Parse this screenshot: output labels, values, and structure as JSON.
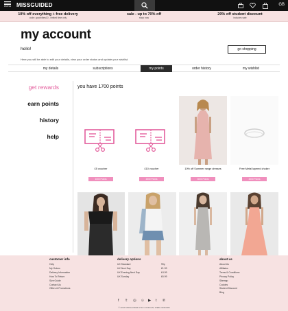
{
  "topbar": {
    "menu_label": "menu",
    "logo": "MISSGUIDED",
    "region": "GB"
  },
  "promo": [
    {
      "title": "10% off everything + free delivery",
      "sub": "code: goodvibes10 - limited time only"
    },
    {
      "title": "sale - up to 70% off",
      "sub": "shop now"
    },
    {
      "title": "20% off student discount",
      "sub": "includes sale"
    }
  ],
  "account": {
    "title": "my account",
    "greeting": "hello!",
    "shop_button": "go shopping",
    "description": "Here you will be able to edit your details, view your order status and update your wishlist."
  },
  "tabs": [
    "my details",
    "subscriptions",
    "my points",
    "order history",
    "my wishlist"
  ],
  "active_tab": "my points",
  "sidebar": [
    "get rewards",
    "earn points",
    "history",
    "help"
  ],
  "points_heading": "you have 1700 points",
  "rewards": [
    {
      "caption": "£5 voucher",
      "points": "1000 Points",
      "icon": "voucher-scissors-icon"
    },
    {
      "caption": "£10 voucher",
      "points": "2000 Points",
      "icon": "voucher-scissors-icon"
    },
    {
      "caption": "10% off Summer range dresses",
      "points": "3000 Points",
      "icon": "dress-photo"
    },
    {
      "caption": "Free Metal layered choker",
      "points": "2000 Points",
      "icon": "choker-photo"
    }
  ],
  "products": [
    "bardot-top-photo",
    "denim-shorts-photo",
    "grey-midi-dress-photo",
    "pink-maxi-dress-photo"
  ],
  "footer": {
    "customer_info": {
      "heading": "customer info",
      "links": [
        "Help",
        "My Orders",
        "Delivery Information",
        "How To Return",
        "Size Guide",
        "Contact Us",
        "Offers & Promotions"
      ]
    },
    "delivery_options": {
      "heading": "delivery options",
      "rows": [
        {
          "name": "UK Standard",
          "price": "99p"
        },
        {
          "name": "UK Next Day",
          "price": "£1.99"
        },
        {
          "name": "UK Evening Next Day",
          "price": "£4.99"
        },
        {
          "name": "UK Sunday",
          "price": "£6.99"
        }
      ]
    },
    "about_us": {
      "heading": "about us",
      "links": [
        "About Us",
        "Affiliates",
        "Terms & Conditions",
        "Privacy Policy",
        "Sitemap",
        "Cookies",
        "Student Discount",
        "Blog"
      ]
    },
    "copyright": "© 2016 MISSGUIDED LTD // OFFICIAL WEB UNIFORM"
  },
  "colors": {
    "accent": "#e35d9c",
    "points_button": "#f08fbd",
    "promo_bg": "#f7e2e2",
    "topbar": "#111111"
  }
}
